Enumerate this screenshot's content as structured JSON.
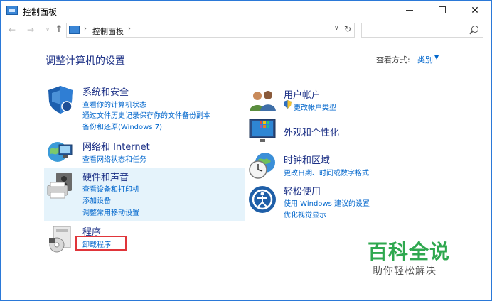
{
  "window": {
    "title": "控制面板",
    "controls": {
      "minimize": "—",
      "maximize": "☐",
      "close": "✕"
    }
  },
  "nav": {
    "back": "←",
    "forward": "→",
    "recent": "∨",
    "up": "↑",
    "address_sep": "›",
    "address_text": "控制面板",
    "address_dropdown": "∨",
    "refresh": "↻",
    "search_placeholder": ""
  },
  "content": {
    "heading": "调整计算机的设置",
    "view_by_label": "查看方式:",
    "view_by_value": "类别",
    "view_by_caret": "▼"
  },
  "categories": {
    "system": {
      "title": "系统和安全",
      "links": [
        "查看你的计算机状态",
        "通过文件历史记录保存你的文件备份副本",
        "备份和还原(Windows 7)"
      ]
    },
    "network": {
      "title": "网络和 Internet",
      "links": [
        "查看网络状态和任务"
      ]
    },
    "hardware": {
      "title": "硬件和声音",
      "links": [
        "查看设备和打印机",
        "添加设备",
        "调整常用移动设置"
      ]
    },
    "programs": {
      "title": "程序",
      "links": [
        "卸载程序"
      ]
    },
    "user": {
      "title": "用户帐户",
      "links": [
        "更改帐户类型"
      ]
    },
    "appearance": {
      "title": "外观和个性化",
      "links": []
    },
    "clock": {
      "title": "时钟和区域",
      "links": [
        "更改日期、时间或数字格式"
      ]
    },
    "ease": {
      "title": "轻松使用",
      "links": [
        "使用 Windows 建议的设置",
        "优化视觉显示"
      ]
    }
  },
  "watermark": {
    "logo": "百科全说",
    "subtitle": "助你轻松解决"
  },
  "colors": {
    "link": "#0066cc",
    "category_title": "#1e3287",
    "highlight": "#e5f3fb",
    "annotation_box": "#e0353a",
    "watermark_green": "#2fa84f"
  }
}
